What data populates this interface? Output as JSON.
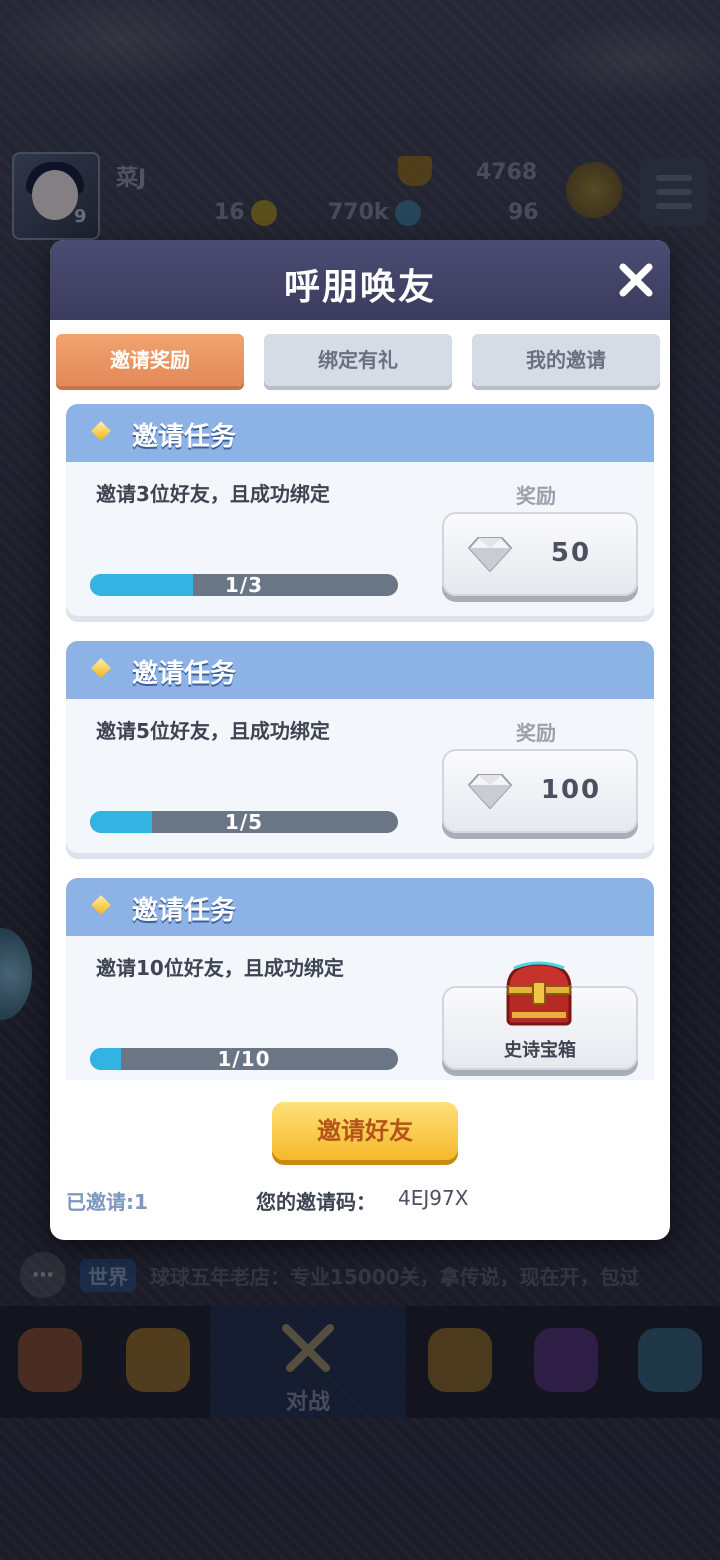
{
  "hud": {
    "player_name": "菜J",
    "level": "9",
    "trophies": "4768",
    "stat_1": "16",
    "coins": "770k",
    "gems": "96"
  },
  "chat": {
    "channel": "世界",
    "message": "球球五年老店：专业15000关，拿传说，现在开，包过"
  },
  "nav": {
    "battle_label": "对战"
  },
  "dialog": {
    "title": "呼朋唤友",
    "tabs": [
      {
        "label": "邀请奖励",
        "active": true
      },
      {
        "label": "绑定有礼",
        "active": false
      },
      {
        "label": "我的邀请",
        "active": false
      }
    ],
    "tasks": [
      {
        "title": "邀请任务",
        "description": "邀请3位好友，且成功绑定",
        "reward_label": "奖励",
        "progress_text": "1/3",
        "progress": 0.3333,
        "reward_amount": "50",
        "reward_icon": "diamond-icon"
      },
      {
        "title": "邀请任务",
        "description": "邀请5位好友，且成功绑定",
        "reward_label": "奖励",
        "progress_text": "1/5",
        "progress": 0.2,
        "reward_amount": "100",
        "reward_icon": "diamond-icon"
      },
      {
        "title": "邀请任务",
        "description": "邀请10位好友，且成功绑定",
        "reward_label": "",
        "progress_text": "1/10",
        "progress": 0.1,
        "reward_name": "史诗宝箱",
        "reward_icon": "treasure-chest-icon"
      }
    ],
    "invite_button": "邀请好友",
    "invited_count": "已邀请:1",
    "code_label": "您的邀请码：",
    "code_value": "4EJ97X"
  },
  "colors": {
    "header": "#3b3c5e",
    "active_tab": "#e98f5f",
    "card_header": "#8db2e6",
    "progress_fill": "#33b3e2",
    "invite_button": "#f5b92a"
  }
}
